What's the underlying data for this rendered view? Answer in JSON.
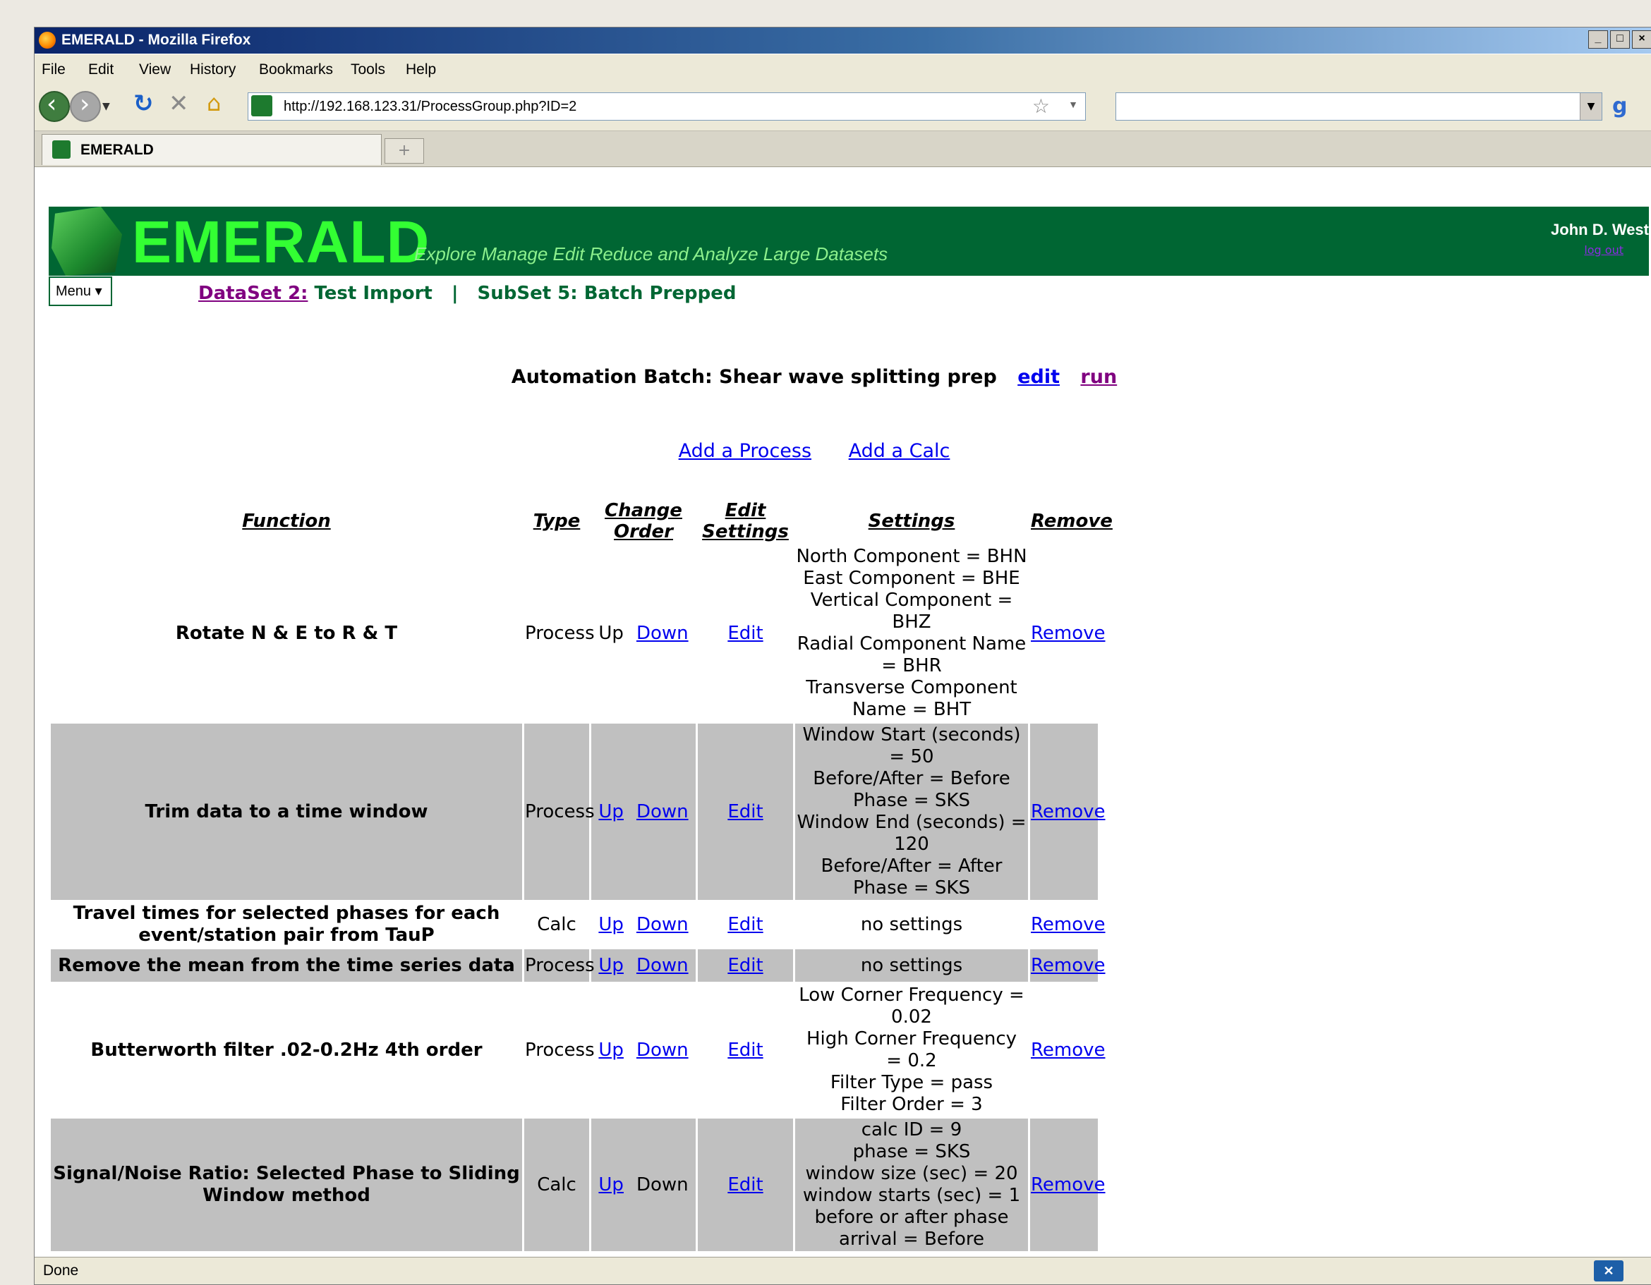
{
  "window": {
    "title": "EMERALD - Mozilla Firefox"
  },
  "menu": [
    "File",
    "Edit",
    "View",
    "History",
    "Bookmarks",
    "Tools",
    "Help"
  ],
  "nav": {
    "url": "http://192.168.123.31/ProcessGroup.php?ID=2"
  },
  "tab": {
    "label": "EMERALD"
  },
  "banner": {
    "logo_text": "EMERALD",
    "tagline": "Explore  Manage  Edit  Reduce  and  Analyze  Large  Datasets",
    "user": "John D. West",
    "logout": "log out"
  },
  "page_menu": {
    "label": "Menu"
  },
  "crumbs": {
    "dataset_link": "DataSet 2:",
    "dataset_name": "Test Import",
    "separator": "|",
    "subset": "SubSet 5: Batch Prepped"
  },
  "batch": {
    "title": "Automation Batch: Shear wave splitting prep",
    "edit": "edit",
    "run": "run"
  },
  "actions": {
    "add_process": "Add a Process",
    "add_calc": "Add a Calc"
  },
  "table": {
    "headers": {
      "function": "Function",
      "type": "Type",
      "order": "Change Order",
      "edit": "Edit Settings",
      "settings": "Settings",
      "remove": "Remove"
    },
    "up_label": "Up",
    "down_label": "Down",
    "edit_label": "Edit",
    "remove_label": "Remove",
    "rows": [
      {
        "function": "Rotate N & E to R & T",
        "type": "Process",
        "up_link": false,
        "down_link": true,
        "settings": [
          "North Component = BHN",
          "East Component = BHE",
          "Vertical Component = BHZ",
          "Radial Component Name = BHR",
          "Transverse Component Name = BHT"
        ]
      },
      {
        "function": "Trim data to a time window",
        "type": "Process",
        "up_link": true,
        "down_link": true,
        "settings": [
          "Window Start (seconds) = 50",
          "Before/After = Before",
          "Phase = SKS",
          "Window End (seconds) = 120",
          "Before/After = After",
          "Phase = SKS"
        ]
      },
      {
        "function": "Travel times for selected phases for each event/station pair from TauP",
        "type": "Calc",
        "up_link": true,
        "down_link": true,
        "settings": [
          "no settings"
        ]
      },
      {
        "function": "Remove the mean from the time series data",
        "type": "Process",
        "up_link": true,
        "down_link": true,
        "settings": [
          "no settings"
        ]
      },
      {
        "function": "Butterworth filter .02-0.2Hz 4th order",
        "type": "Process",
        "up_link": true,
        "down_link": true,
        "settings": [
          "Low Corner Frequency = 0.02",
          "High Corner Frequency = 0.2",
          "Filter Type = pass",
          "Filter Order = 3"
        ]
      },
      {
        "function": "Signal/Noise Ratio: Selected Phase to Sliding Window method",
        "type": "Calc",
        "up_link": true,
        "down_link": false,
        "settings": [
          "calc ID = 9",
          "phase = SKS",
          "window size (sec) = 20",
          "window starts (sec) = 1",
          "before or after phase arrival = Before"
        ]
      }
    ]
  },
  "status": {
    "text": "Done"
  }
}
